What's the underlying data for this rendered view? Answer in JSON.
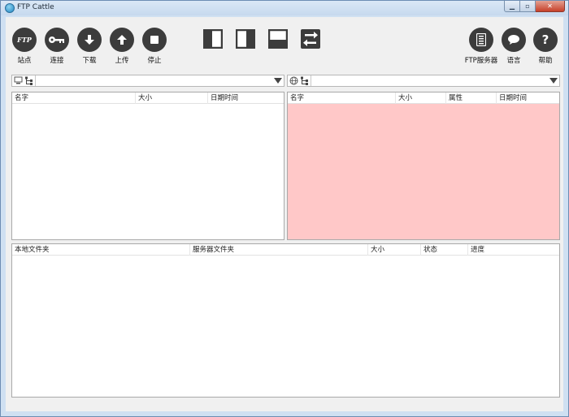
{
  "window": {
    "title": "FTP Cattle",
    "minimize_glyph": "▁",
    "maximize_glyph": "▫",
    "close_glyph": "✕"
  },
  "toolbar": {
    "site_label": "站点",
    "site_icon_text": "FTP",
    "connect_label": "连接",
    "download_label": "下载",
    "upload_label": "上传",
    "stop_label": "停止",
    "ftp_server_label": "FTP服务器",
    "language_label": "语言",
    "help_label": "帮助",
    "help_icon_text": "?"
  },
  "local_pane": {
    "columns": [
      "名字",
      "大小",
      "日期时间"
    ],
    "path_value": ""
  },
  "remote_pane": {
    "columns": [
      "名字",
      "大小",
      "属性",
      "日期时间"
    ],
    "path_value": "",
    "background_color": "#ffc8c8"
  },
  "transfer_pane": {
    "columns": [
      "本地文件夹",
      "服务器文件夹",
      "大小",
      "状态",
      "进度"
    ]
  },
  "colors": {
    "toolbar_icon": "#3c3c3c",
    "window_frame": "#cfe0f2",
    "client_bg": "#f0f0f0"
  }
}
